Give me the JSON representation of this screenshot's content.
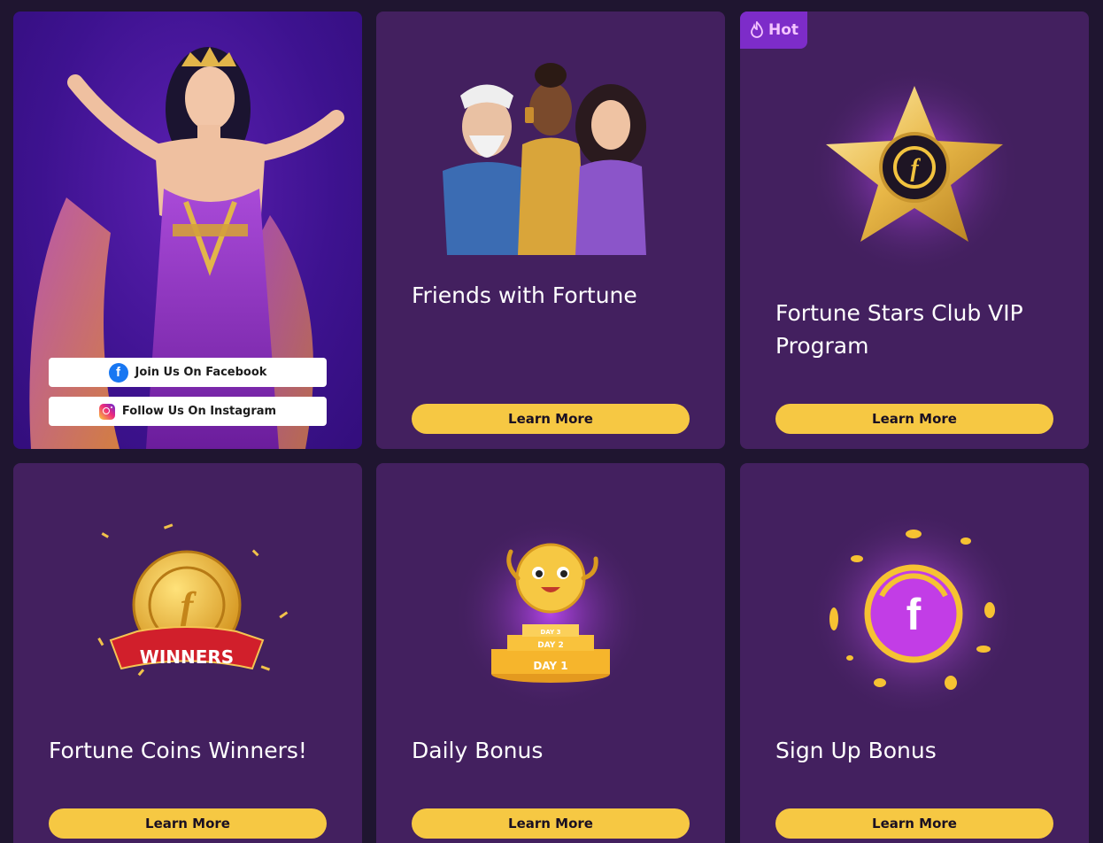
{
  "social": {
    "facebook_label": "Join Us On Facebook",
    "instagram_label": "Follow Us On Instagram"
  },
  "cards": [
    {
      "title": "Friends with Fortune",
      "button": "Learn More"
    },
    {
      "badge": "Hot",
      "title": "Fortune Stars Club VIP Program",
      "button": "Learn More"
    },
    {
      "title": "Fortune Coins Winners!",
      "button": "Learn More",
      "banner_text": "WINNERS"
    },
    {
      "title": "Daily Bonus",
      "button": "Learn More",
      "steps": [
        "DAY 3",
        "DAY 2",
        "DAY 1"
      ]
    },
    {
      "title": "Sign Up Bonus",
      "button": "Learn More"
    }
  ],
  "colors": {
    "page_bg": "#1f1530",
    "card_bg": "#43205f",
    "button_bg": "#f6c843",
    "hot_badge": "#7d2cc9",
    "facebook": "#1877f2"
  },
  "icons": {
    "coin_letter": "f",
    "facebook_letter": "f"
  }
}
